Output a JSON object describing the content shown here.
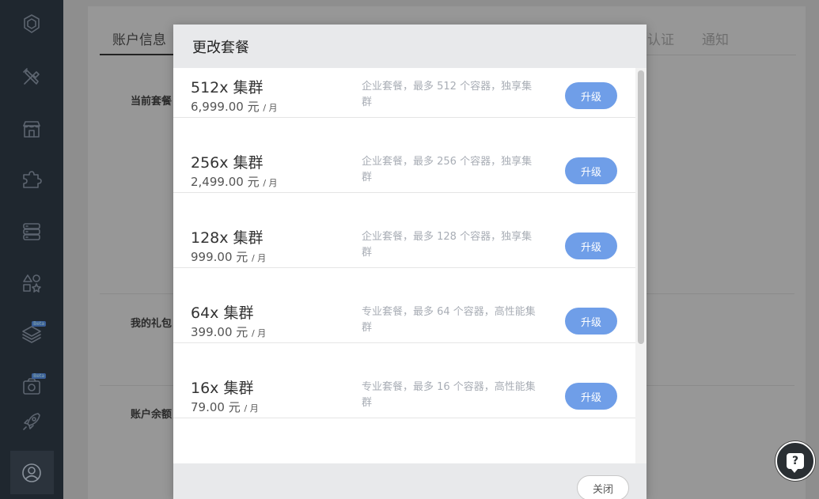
{
  "background": {
    "tabs": [
      {
        "label": "账户信息"
      },
      {
        "label": "认证"
      },
      {
        "label": "通知"
      }
    ],
    "sections": [
      {
        "label": "当前套餐"
      },
      {
        "label": "我的礼包"
      },
      {
        "label": "账户余额"
      }
    ]
  },
  "sidebar": {
    "icons": [
      "logo-icon",
      "tools-icon",
      "store-icon",
      "puzzle-icon",
      "server-icon",
      "shapes-icon",
      "layers-icon",
      "camera-icon",
      "rocket-icon",
      "user-icon"
    ],
    "beta_badge": "Beta"
  },
  "modal": {
    "title": "更改套餐",
    "plans": [
      {
        "name": "512x 集群",
        "price": "6,999.00 元",
        "unit": "/ 月",
        "desc": "企业套餐，最多 512 个容器，独享集群",
        "button": "升级"
      },
      {
        "name": "256x 集群",
        "price": "2,499.00 元",
        "unit": "/ 月",
        "desc": "企业套餐，最多 256 个容器，独享集群",
        "button": "升级"
      },
      {
        "name": "128x 集群",
        "price": "999.00 元",
        "unit": "/ 月",
        "desc": "企业套餐，最多 128 个容器，独享集群",
        "button": "升级"
      },
      {
        "name": "64x 集群",
        "price": "399.00 元",
        "unit": "/ 月",
        "desc": "专业套餐，最多 64 个容器，高性能集群",
        "button": "升级"
      },
      {
        "name": "16x 集群",
        "price": "79.00 元",
        "unit": "/ 月",
        "desc": "专业套餐，最多 16 个容器，高性能集群",
        "button": "升级"
      }
    ],
    "close_label": "关闭"
  },
  "colors": {
    "accent": "#6f9ee8",
    "sidebar": "#1f272f",
    "header": "#e8e9eb"
  },
  "help": {
    "icon": "help-bubble-icon",
    "glyph": "?"
  }
}
